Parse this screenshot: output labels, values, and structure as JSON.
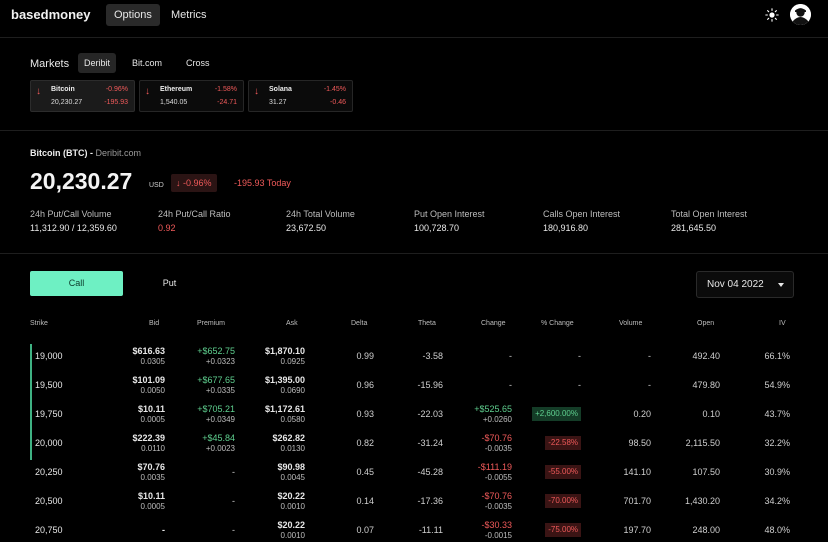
{
  "app": {
    "brand": "basedmoney",
    "nav": [
      "Options",
      "Metrics"
    ]
  },
  "markets": {
    "title": "Markets",
    "tabs": [
      "Deribit",
      "Bit.com",
      "Cross"
    ],
    "cards": [
      {
        "name": "Bitcoin",
        "pct": "-0.96%",
        "price": "20,230.27",
        "change": "-195.93"
      },
      {
        "name": "Ethereum",
        "pct": "-1.58%",
        "price": "1,540.05",
        "change": "-24.71"
      },
      {
        "name": "Solana",
        "pct": "-1.45%",
        "price": "31.27",
        "change": "-0.46"
      }
    ]
  },
  "summary": {
    "pair": "Bitcoin (BTC) - ",
    "source": "Deribit.com",
    "price": "20,230.27",
    "unit": "USD",
    "pct": "-0.96%",
    "today": "-195.93 Today",
    "stats": [
      {
        "label": "24h Put/Call Volume",
        "value": "11,312.90 / 12,359.60"
      },
      {
        "label": "24h Put/Call Ratio",
        "value": "0.92"
      },
      {
        "label": "24h Total Volume",
        "value": "23,672.50"
      },
      {
        "label": "Put Open Interest",
        "value": "100,728.70"
      },
      {
        "label": "Calls Open Interest",
        "value": "180,916.80"
      },
      {
        "label": "Total Open Interest",
        "value": "281,645.50"
      }
    ]
  },
  "options": {
    "tabs": {
      "call": "Call",
      "put": "Put"
    },
    "expiry": "Nov 04 2022",
    "columns": [
      "Strike",
      "Bid",
      "Premium",
      "Ask",
      "Delta",
      "Theta",
      "Change",
      "% Change",
      "Volume",
      "Open",
      "IV"
    ],
    "rows": [
      {
        "strike": "19,000",
        "bid": "$616.63",
        "bid_sub": "0.0305",
        "premium": "+$652.75",
        "premium_sub": "+0.0323",
        "ask": "$1,870.10",
        "ask_sub": "0.0925",
        "delta": "0.99",
        "theta": "-3.58",
        "change": "-",
        "change_sub": "",
        "pct_change": "-",
        "volume": "-",
        "open": "492.40",
        "iv": "66.1%"
      },
      {
        "strike": "19,500",
        "bid": "$101.09",
        "bid_sub": "0.0050",
        "premium": "+$677.65",
        "premium_sub": "+0.0335",
        "ask": "$1,395.00",
        "ask_sub": "0.0690",
        "delta": "0.96",
        "theta": "-15.96",
        "change": "-",
        "change_sub": "",
        "pct_change": "-",
        "volume": "-",
        "open": "479.80",
        "iv": "54.9%"
      },
      {
        "strike": "19,750",
        "bid": "$10.11",
        "bid_sub": "0.0005",
        "premium": "+$705.21",
        "premium_sub": "+0.0349",
        "ask": "$1,172.61",
        "ask_sub": "0.0580",
        "delta": "0.93",
        "theta": "-22.03",
        "change": "+$525.65",
        "change_sub": "+0.0260",
        "pct_change": "+2,600.00%",
        "volume": "0.20",
        "open": "0.10",
        "iv": "43.7%"
      },
      {
        "strike": "20,000",
        "bid": "$222.39",
        "bid_sub": "0.0110",
        "premium": "+$45.84",
        "premium_sub": "+0.0023",
        "ask": "$262.82",
        "ask_sub": "0.0130",
        "delta": "0.82",
        "theta": "-31.24",
        "change": "-$70.76",
        "change_sub": "-0.0035",
        "pct_change": "-22.58%",
        "volume": "98.50",
        "open": "2,115.50",
        "iv": "32.2%"
      },
      {
        "strike": "20,250",
        "bid": "$70.76",
        "bid_sub": "0.0035",
        "premium": "-",
        "premium_sub": "",
        "ask": "$90.98",
        "ask_sub": "0.0045",
        "delta": "0.45",
        "theta": "-45.28",
        "change": "-$111.19",
        "change_sub": "-0.0055",
        "pct_change": "-55.00%",
        "volume": "141.10",
        "open": "107.50",
        "iv": "30.9%"
      },
      {
        "strike": "20,500",
        "bid": "$10.11",
        "bid_sub": "0.0005",
        "premium": "-",
        "premium_sub": "",
        "ask": "$20.22",
        "ask_sub": "0.0010",
        "delta": "0.14",
        "theta": "-17.36",
        "change": "-$70.76",
        "change_sub": "-0.0035",
        "pct_change": "-70.00%",
        "volume": "701.70",
        "open": "1,430.20",
        "iv": "34.2%"
      },
      {
        "strike": "20,750",
        "bid": "-",
        "bid_sub": "",
        "premium": "-",
        "premium_sub": "",
        "ask": "$20.22",
        "ask_sub": "0.0010",
        "delta": "0.07",
        "theta": "-11.11",
        "change": "-$30.33",
        "change_sub": "-0.0015",
        "pct_change": "-75.00%",
        "volume": "197.70",
        "open": "248.00",
        "iv": "48.0%"
      }
    ]
  },
  "colors": {
    "accent": "#6ef0c3",
    "up": "#5fd08f",
    "down": "#f05a5a",
    "background": "#000000"
  },
  "icons": {
    "theme": "sun-icon",
    "account": "avatar-icon",
    "down": "arrow-down-icon",
    "dropdown": "chevron-down-icon"
  }
}
